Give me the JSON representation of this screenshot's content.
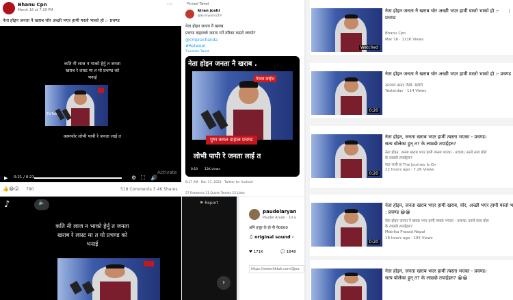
{
  "fb": {
    "author": "Bhanu Cpn",
    "date": "March 16 at 7:29 PM ·",
    "more": "···",
    "caption": "नेता होइन जनता नै खराब चोर अच्छी भएर हामी यस्तो भाको हो :- प्रचण्ड",
    "video_line1": "कति नी लाज न भाको हेर्नु त जनता",
    "video_line2": "खराब रे लास्ट मा त यो प्रचण्ड को",
    "video_line3": "भनाई",
    "video_bottom": "कामचोर लोभी पापी रे जनता लाई त",
    "tiktok": "TikTok",
    "time": "0:21 / 0:21",
    "reactions": "780",
    "stats": "518 Comments  3.4K Shares",
    "activate": "Activate"
  },
  "tw": {
    "pinned": "Pinned Tweet",
    "name": "kiran joshi",
    "handle": "@kiranjoshi219",
    "text1": "नेता होइन जनता नै खराब",
    "text2": "प्रचण्ड दाहालले जनता गर्ने तरिका कस्तो लाग्यो?",
    "mention": "@cmprachanda",
    "hashtag": "#Retweet",
    "translate": "Translate Tweet",
    "banner_top": "नेता होइन जनता नै खराब .",
    "banner_red": "नेपाल लाईभ",
    "banner_name": "पुष्प कमल दाहाल प्रचण्ड",
    "banner_bottom": "लोभी पापी रे जनता लाई त",
    "views": "13K views",
    "vtime": "0:10",
    "footer": "8:17 AM · Mar 17, 2021 · Twitter for Android",
    "stats": "57 Retweets   11 Quote Tweets   15 Likes"
  },
  "yt": [
    {
      "title": "नेता होइन जनता नै खराब चोर अच्छी भएर हामी यस्तो भाको हो :-",
      "title2": "प्रचण्ड",
      "ch": "Bhanu Cpn",
      "info": "Mar 16 · 111K Views",
      "dur": "Watched",
      "tt": ""
    },
    {
      "title": "नेता होइन जनता नै खराब चोर अच्छी भएर हामी यस्तो भाको हो :- प्रचण्ड",
      "title2": "",
      "ch": "नारायण प्रसाद जैसी- बेलोरी",
      "info": "Yesterday · 114 Views",
      "dur": "0:20",
      "tt": ""
    },
    {
      "title": "नेता होइन, जनता खराब भएर हामी त्यस्ता भएका - प्रचण्ड।",
      "title2": "सत्य बोलेका हुन् त? के लाछ्छे तपाईहरु?",
      "ch": "नेता होइन, जनता खराब भएर हामी त्यस्ता भएका - प्रचण्ड। उनले सत्य बोले",
      "ch2": "के लाछ्छे तपाईहरु?",
      "sub": "पाठ जारी छ The Journey Is On",
      "info": "22 hours ago · 7.2K Views",
      "dur": "0:20"
    },
    {
      "title": "नेता होइन, जनता खराब भएर हामी खराब, चोर, अच्छी भएर हामी यस्तो भाको हो",
      "title2": ": प्रचण्ड 😀😀",
      "ch": "नेता होइन जनता नै खराब भएर हामी त्यस्ता भएका - प्रचण्ड। उनले सत्य बोल",
      "ch2": "के लाछ्छे तपाईहरु?",
      "sub": "Matrika Prasad Nepal",
      "info": "18 hours ago · 105 Views",
      "dur": "0:20"
    },
    {
      "title": "नेता होइन, जनता खराब भएर हामी त्यस्ता भएका - प्रचण्ड।",
      "title2": "सत्य बोलेका हुन् त? के लाछ्छे तपाईहरु? 😀😀",
      "ch": "",
      "info": "",
      "dur": ""
    }
  ],
  "tk": {
    "line1": "कति नी लाज न भाको हेर्नु त जनता",
    "line2": "खराब रे लास्ट मा त यो प्रचण्ड को",
    "line3": "भनाई",
    "report": "Report"
  },
  "pl": {
    "user": "paudelaryan",
    "handle": "Paudel Aryan · 1d a",
    "text": "अनि हजुर के हो नी ये0000",
    "sound": "original sound - ",
    "likes": "171K",
    "comments": "1848",
    "url": "https://www.tiktok.com/@pa"
  }
}
